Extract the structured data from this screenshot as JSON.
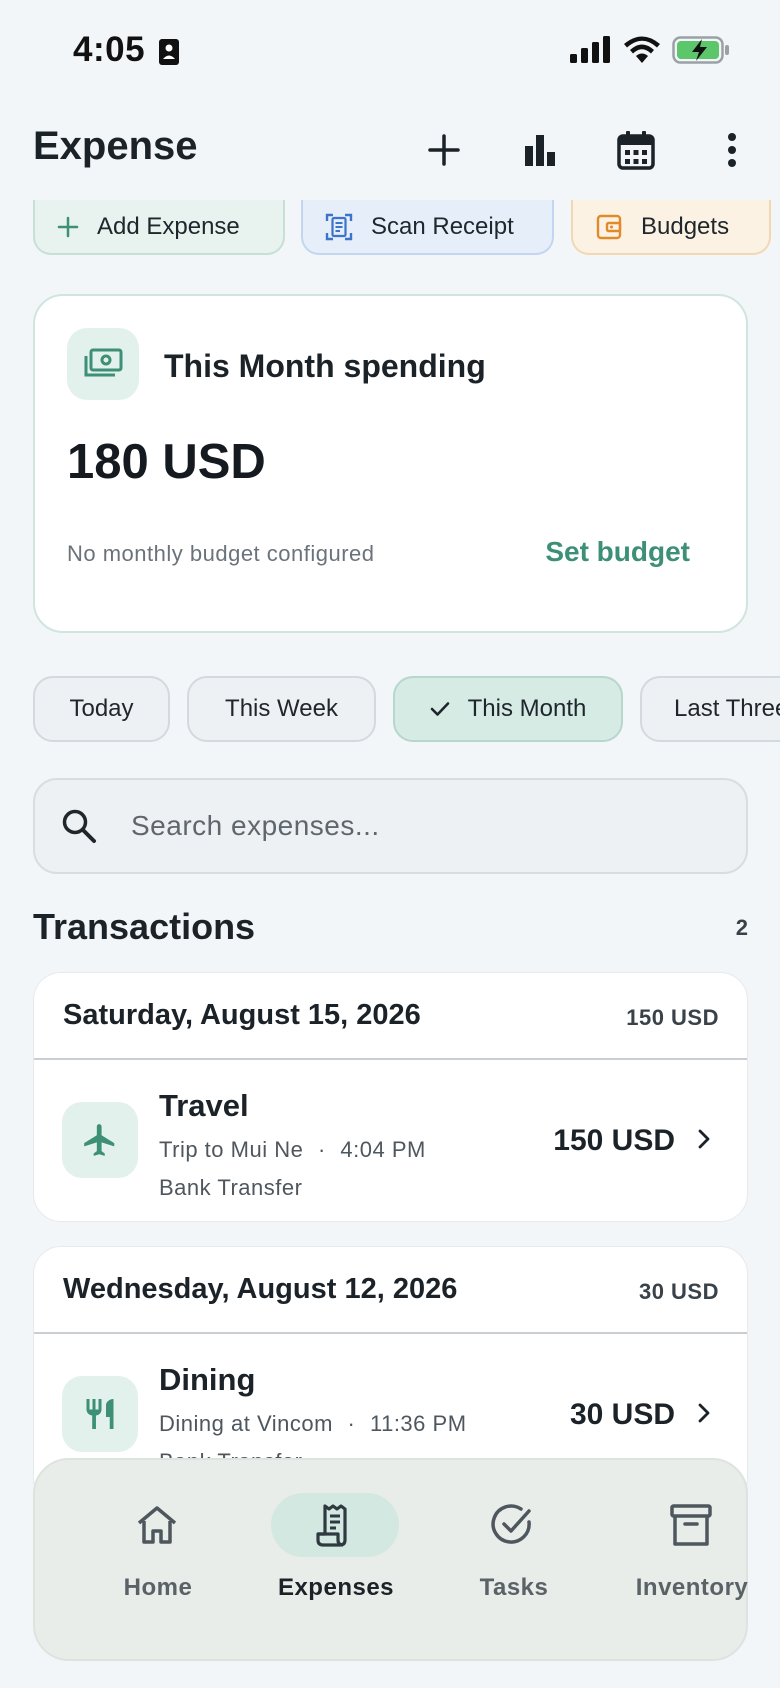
{
  "status_bar": {
    "time": "4:05"
  },
  "app_bar": {
    "title": "Expense",
    "actions": [
      "add-icon",
      "bar-chart-icon",
      "calendar-icon",
      "more-vert-icon"
    ]
  },
  "quick_actions": [
    {
      "label": "Add Expense",
      "icon": "plus-icon",
      "color": "#3d8f76"
    },
    {
      "label": "Scan Receipt",
      "icon": "document-scanner-icon",
      "color": "#3c74c9"
    },
    {
      "label": "Budgets",
      "icon": "wallet-icon",
      "color": "#e18a2b"
    }
  ],
  "spending_card": {
    "title": "This Month spending",
    "amount": "180 USD",
    "note": "No monthly budget configured",
    "action": "Set budget"
  },
  "filters": [
    {
      "label": "Today",
      "selected": false
    },
    {
      "label": "This Week",
      "selected": false
    },
    {
      "label": "This Month",
      "selected": true
    },
    {
      "label": "Last Three Months",
      "selected": false
    }
  ],
  "search": {
    "placeholder": "Search expenses..."
  },
  "transactions": {
    "title": "Transactions",
    "count": "2",
    "groups": [
      {
        "date": "Saturday, August 15, 2026",
        "total": "150 USD",
        "items": [
          {
            "category": "Travel",
            "description": "Trip to Mui Ne",
            "separator": "·",
            "time": "4:04 PM",
            "method": "Bank Transfer",
            "amount": "150 USD",
            "icon": "airplane-icon"
          }
        ]
      },
      {
        "date": "Wednesday, August 12, 2026",
        "total": "30 USD",
        "items": [
          {
            "category": "Dining",
            "description": "Dining at Vincom",
            "separator": "·",
            "time": "11:36 PM",
            "method": "Bank Transfer",
            "amount": "30 USD",
            "icon": "restaurant-icon"
          }
        ]
      }
    ]
  },
  "bottom_nav": [
    {
      "label": "Home",
      "icon": "home-icon",
      "active": false
    },
    {
      "label": "Expenses",
      "icon": "receipt-icon",
      "active": true
    },
    {
      "label": "Tasks",
      "icon": "check-circle-icon",
      "active": false
    },
    {
      "label": "Inventory",
      "icon": "archive-icon",
      "active": false
    }
  ],
  "colors": {
    "accent": "#3d8f76",
    "background": "#f3f6f8",
    "selected_chip": "#d5ebe4"
  }
}
